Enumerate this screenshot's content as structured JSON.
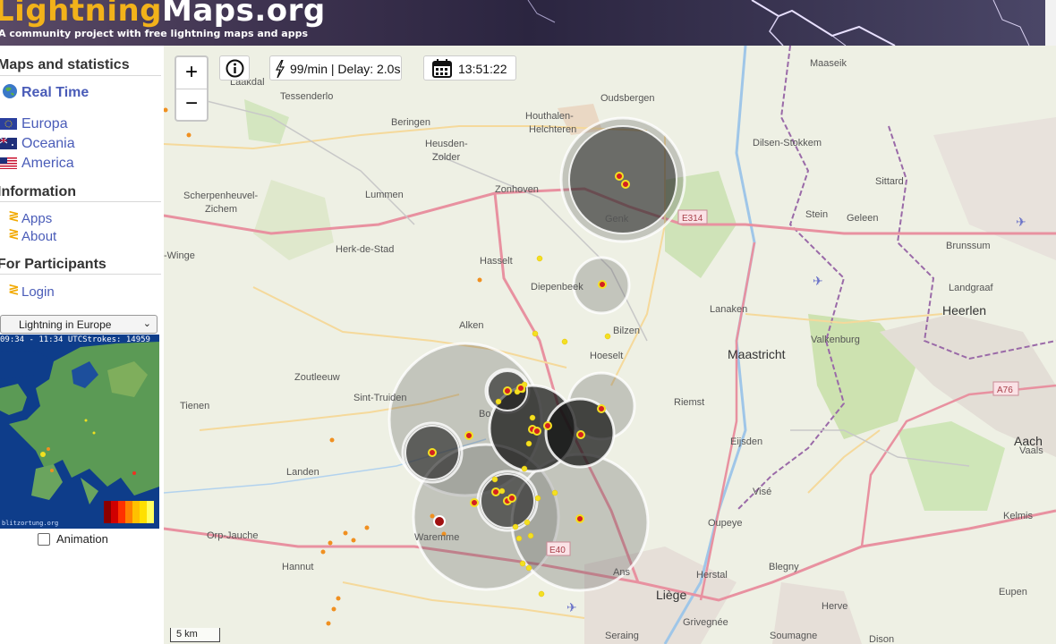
{
  "header": {
    "logo_part1": "Lightning",
    "logo_part2": "Maps.org",
    "tagline": "A community project with free lightning maps and apps"
  },
  "sidebar": {
    "maps_heading": "Maps and statistics",
    "realtime_label": "Real Time",
    "regions": [
      {
        "label": "Europa",
        "flag_icon": "eu-flag-icon"
      },
      {
        "label": "Oceania",
        "flag_icon": "australia-flag-icon"
      },
      {
        "label": "America",
        "flag_icon": "usa-flag-icon"
      }
    ],
    "info_heading": "Information",
    "info_links": [
      "Apps",
      "About"
    ],
    "participants_heading": "For Participants",
    "participant_links": [
      "Login"
    ],
    "select_value": "Lightning in Europe",
    "minimap_caption": "09:34 - 11:34 UTCStrokes: 14959",
    "minimap_watermark": "blitzortung.org",
    "animation_label": "Animation"
  },
  "map_controls": {
    "zoom_in": "+",
    "zoom_out": "−",
    "rate_text": "99/min | Delay: 2.0s",
    "clock_text": "13:51:22",
    "scale_text": "5 km"
  },
  "places": {
    "p1": "Laakdal",
    "p2": "Tessenderlo",
    "p3": "Beringen",
    "p4": "Houthalen-",
    "p5": "Helchteren",
    "p6": "Oudsbergen",
    "p7": "Maaseik",
    "p8": "Heusden-",
    "p9": "Zolder",
    "p10": "Dilsen-Stokkem",
    "p11": "Scherpenheuvel-",
    "p12": "Zichem",
    "p13": "Lummen",
    "p14": "Zonhoven",
    "p15": "Genk",
    "p16": "Sittard",
    "p17": "Stein",
    "p18": "Geleen",
    "p19": "Brunssum",
    "p20": "Herk-de-Stad",
    "p21": "Hasselt",
    "p22": "Diepenbeek",
    "p23": "Landgraaf",
    "p24": "Lanaken",
    "p25": "Heerlen",
    "p26": "Bilzen",
    "p27": "Alken",
    "p28": "Hoeselt",
    "p29": "Valkenburg",
    "p30": "Maastricht",
    "p31": "Zoutleeuw",
    "p32": "Sint-Truiden",
    "p33": "Riemst",
    "p34": "Tienen",
    "p35": "Eijsden",
    "p36": "Vaals",
    "p37": "Aach",
    "p38": "Landen",
    "p39": "Visé",
    "p40": "Kelmis",
    "p41": "Orp-Jauche",
    "p42": "Waremme",
    "p43": "Oupeye",
    "p44": "Hannut",
    "p45": "Blegny",
    "p46": "Herstal",
    "p47": "Liège",
    "p48": "Herve",
    "p49": "Eupen",
    "p50": "Seraing",
    "p51": "Grivegnée",
    "p52": "Soumagne",
    "p53": "Dison",
    "p54": "Ans",
    "p55": "Bo",
    "p56": "-Winge"
  },
  "highways": [
    "E314",
    "A76",
    "E40"
  ],
  "colors": {
    "brand_orange": "#f2b21a",
    "link_blue": "#4a5cb8",
    "strike_red": "#d42020",
    "strike_yellow": "#f3e022",
    "strike_orange": "#f09020"
  }
}
